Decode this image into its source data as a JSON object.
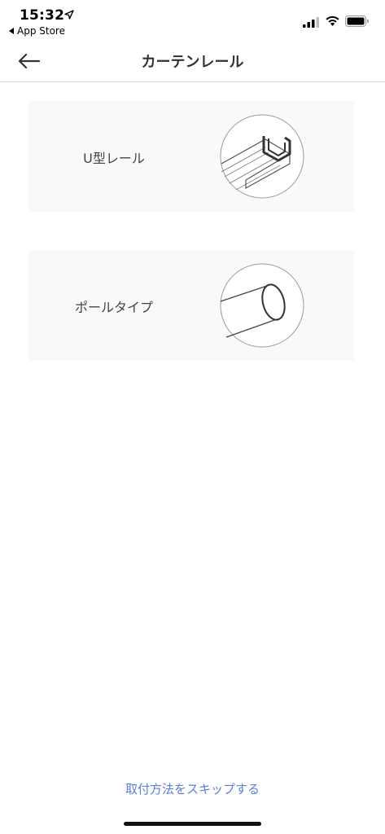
{
  "status_bar": {
    "time": "15:32",
    "back_app": "App Store",
    "icons": [
      "location-arrow-icon",
      "cellular-signal-icon",
      "wifi-icon",
      "battery-icon"
    ]
  },
  "nav": {
    "title": "カーテンレール",
    "back_icon": "arrow-left-icon"
  },
  "options": [
    {
      "label": "U型レール",
      "icon": "u-rail-illustration"
    },
    {
      "label": "ポールタイプ",
      "icon": "pole-illustration"
    }
  ],
  "skip": {
    "label": "取付方法をスキップする"
  },
  "colors": {
    "accent": "#5b7fd6",
    "card_bg": "#f7f9fb",
    "title_text": "#333333",
    "divider": "#d9d9d9"
  }
}
